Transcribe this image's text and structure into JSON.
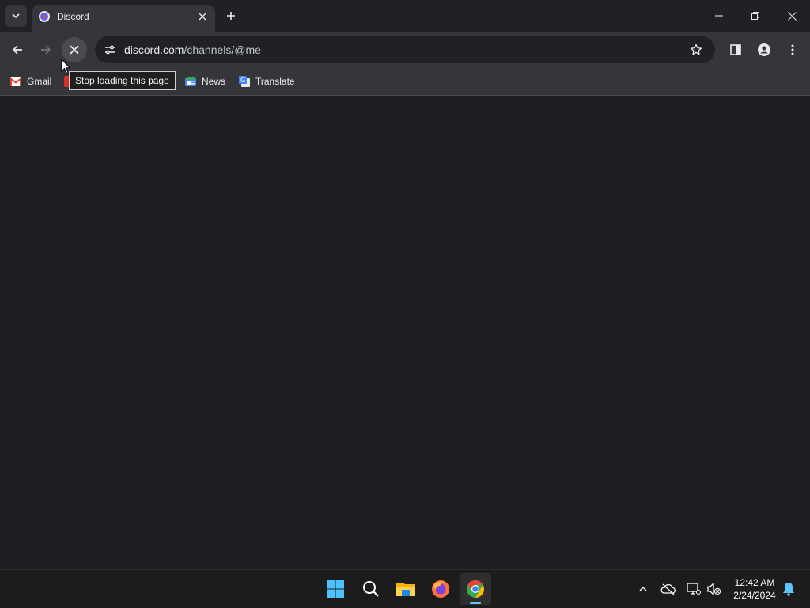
{
  "browser": {
    "tab": {
      "title": "Discord",
      "favicon": "discord-logo-icon"
    },
    "window_controls": [
      "minimize-icon",
      "restore-icon",
      "close-icon"
    ],
    "address": {
      "host": "discord.com",
      "path": "/channels/@me"
    },
    "tooltip": "Stop loading this page",
    "bookmarks": [
      {
        "label": "Gmail",
        "icon": "gmail-icon"
      },
      {
        "label": "News",
        "icon": "news-icon"
      },
      {
        "label": "Translate",
        "icon": "translate-icon"
      }
    ]
  },
  "taskbar": {
    "apps": [
      "windows-start-icon",
      "search-icon",
      "file-explorer-icon",
      "firefox-icon",
      "chrome-icon"
    ],
    "clock": {
      "time": "12:42 AM",
      "date": "2/24/2024"
    }
  },
  "colors": {
    "tabstrip": "#202124",
    "toolbar": "#35363a",
    "content": "#1e1f22",
    "taskbar": "#1c1c1c",
    "active_indicator": "#5cc4f7"
  }
}
